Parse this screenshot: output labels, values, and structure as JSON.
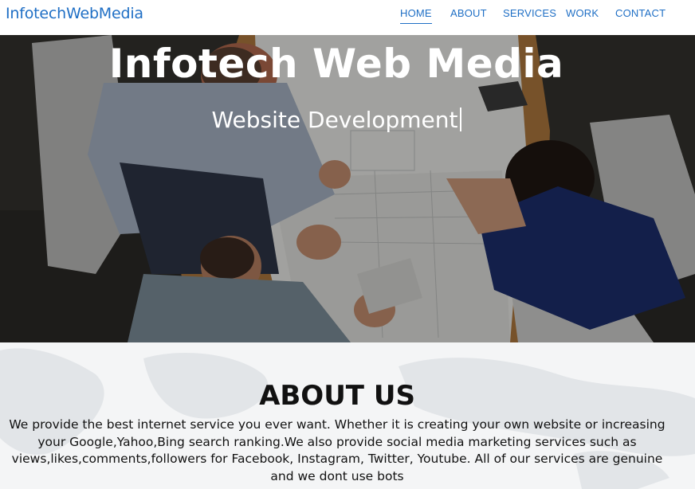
{
  "nav": {
    "brand": "InfotechWebMedia",
    "links": [
      {
        "label": "HOME",
        "active": true
      },
      {
        "label": "ABOUT",
        "active": false
      },
      {
        "label": "SERVICES",
        "active": false
      },
      {
        "label": "WORK",
        "active": false
      },
      {
        "label": "CONTACT",
        "active": false
      }
    ]
  },
  "hero": {
    "title": "Infotech Web Media",
    "subtitle": "Website Development"
  },
  "about": {
    "title": "ABOUT US",
    "text": "We provide the best internet service you ever want. Whether it is creating your own website or increasing your Google,Yahoo,Bing search ranking.We also provide social media marketing services such as views,likes,comments,followers for Facebook, Instagram, Twitter, Youtube. All of our services are genuine and we dont use bots"
  },
  "colors": {
    "accent": "#1f6fc5",
    "hero_overlay": "#2d2c2a",
    "about_bg": "#f4f5f6"
  }
}
